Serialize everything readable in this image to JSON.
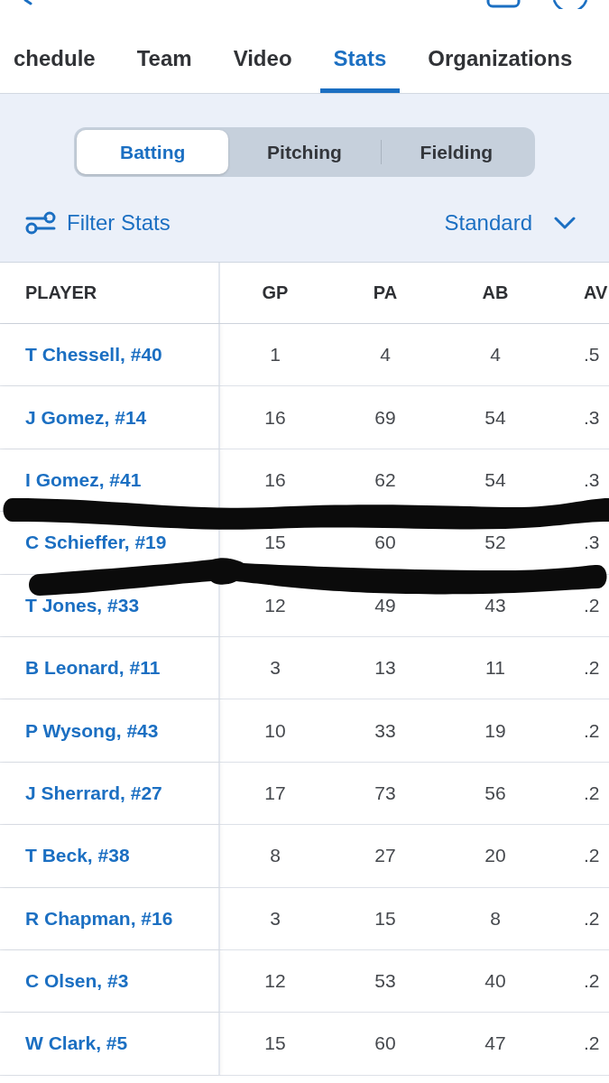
{
  "tabs": [
    {
      "label": "chedule",
      "selected": false
    },
    {
      "label": "Team",
      "selected": false
    },
    {
      "label": "Video",
      "selected": false
    },
    {
      "label": "Stats",
      "selected": true
    },
    {
      "label": "Organizations",
      "selected": false
    }
  ],
  "stat_types": [
    {
      "label": "Batting",
      "selected": true
    },
    {
      "label": "Pitching",
      "selected": false
    },
    {
      "label": "Fielding",
      "selected": false
    }
  ],
  "filter": {
    "label": "Filter Stats"
  },
  "view_select": {
    "value": "Standard"
  },
  "table": {
    "columns": [
      "PLAYER",
      "GP",
      "PA",
      "AB",
      "AV"
    ],
    "rows": [
      [
        "T Chessell, #40",
        "1",
        "4",
        "4",
        ".5"
      ],
      [
        "J Gomez, #14",
        "16",
        "69",
        "54",
        ".3"
      ],
      [
        "I Gomez, #41",
        "16",
        "62",
        "54",
        ".3"
      ],
      [
        "C Schieffer, #19",
        "15",
        "60",
        "52",
        ".3"
      ],
      [
        "T Jones, #33",
        "12",
        "49",
        "43",
        ".2"
      ],
      [
        "B Leonard, #11",
        "3",
        "13",
        "11",
        ".2"
      ],
      [
        "P Wysong, #43",
        "10",
        "33",
        "19",
        ".2"
      ],
      [
        "J Sherrard, #27",
        "17",
        "73",
        "56",
        ".2"
      ],
      [
        "T Beck, #38",
        "8",
        "27",
        "20",
        ".2"
      ],
      [
        "R Chapman, #16",
        "3",
        "15",
        "8",
        ".2"
      ],
      [
        "C Olsen, #3",
        "12",
        "53",
        "40",
        ".2"
      ],
      [
        "W Clark, #5",
        "15",
        "60",
        "47",
        ".2"
      ]
    ]
  },
  "marker_strokes": [
    {
      "kind": "freehand"
    },
    {
      "kind": "freehand"
    }
  ]
}
